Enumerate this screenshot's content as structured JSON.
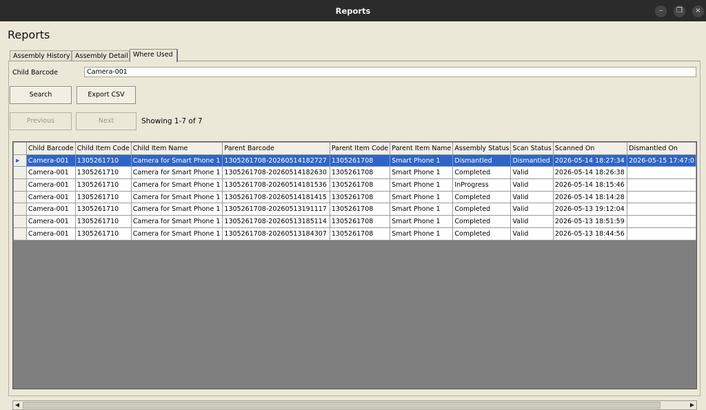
{
  "window": {
    "title": "Reports",
    "minimize_glyph": "–",
    "restore_glyph": "❐",
    "close_glyph": "×"
  },
  "page": {
    "title": "Reports"
  },
  "tabs": [
    {
      "label": "Assembly History"
    },
    {
      "label": "Assembly Detail"
    },
    {
      "label": "Where Used"
    }
  ],
  "active_tab": "Where Used",
  "form": {
    "child_barcode_label": "Child Barcode",
    "child_barcode_value": "Camera-001"
  },
  "buttons": {
    "search": "Search",
    "export": "Export CSV",
    "previous": "Previous",
    "next": "Next"
  },
  "paging": {
    "showing": "Showing 1-7 of 7"
  },
  "grid": {
    "columns": [
      "Child Barcode",
      "Child Item Code",
      "Child Item Name",
      "Parent Barcode",
      "Parent Item Code",
      "Parent Item Name",
      "Assembly Status",
      "Scan Status",
      "Scanned On",
      "Dismantled On"
    ],
    "selected_row_index": 0,
    "rows": [
      [
        "Camera-001",
        "1305261710",
        "Camera for Smart Phone 1",
        "1305261708-20260514182727",
        "1305261708",
        "Smart Phone 1",
        "Dismantled",
        "Dismantled",
        "2026-05-14 18:27:34",
        "2026-05-15 17:47:0"
      ],
      [
        "Camera-001",
        "1305261710",
        "Camera for Smart Phone 1",
        "1305261708-20260514182630",
        "1305261708",
        "Smart Phone 1",
        "Completed",
        "Valid",
        "2026-05-14 18:26:38",
        ""
      ],
      [
        "Camera-001",
        "1305261710",
        "Camera for Smart Phone 1",
        "1305261708-20260514181536",
        "1305261708",
        "Smart Phone 1",
        "InProgress",
        "Valid",
        "2026-05-14 18:15:46",
        ""
      ],
      [
        "Camera-001",
        "1305261710",
        "Camera for Smart Phone 1",
        "1305261708-20260514181415",
        "1305261708",
        "Smart Phone 1",
        "Completed",
        "Valid",
        "2026-05-14 18:14:28",
        ""
      ],
      [
        "Camera-001",
        "1305261710",
        "Camera for Smart Phone 1",
        "1305261708-20260513191117",
        "1305261708",
        "Smart Phone 1",
        "Completed",
        "Valid",
        "2026-05-13 19:12:04",
        ""
      ],
      [
        "Camera-001",
        "1305261710",
        "Camera for Smart Phone 1",
        "1305261708-20260513185114",
        "1305261708",
        "Smart Phone 1",
        "Completed",
        "Valid",
        "2026-05-13 18:51:59",
        ""
      ],
      [
        "Camera-001",
        "1305261710",
        "Camera for Smart Phone 1",
        "1305261708-20260513184307",
        "1305261708",
        "Smart Phone 1",
        "Completed",
        "Valid",
        "2026-05-13 18:44:56",
        ""
      ]
    ]
  },
  "scrollbar": {
    "left_arrow": "◀",
    "right_arrow": "▶"
  },
  "colors": {
    "selection": "#2f66c5",
    "window_bg": "#ece8d8",
    "titlebar": "#2b2b2b",
    "grid_empty": "#7f7f7f"
  }
}
